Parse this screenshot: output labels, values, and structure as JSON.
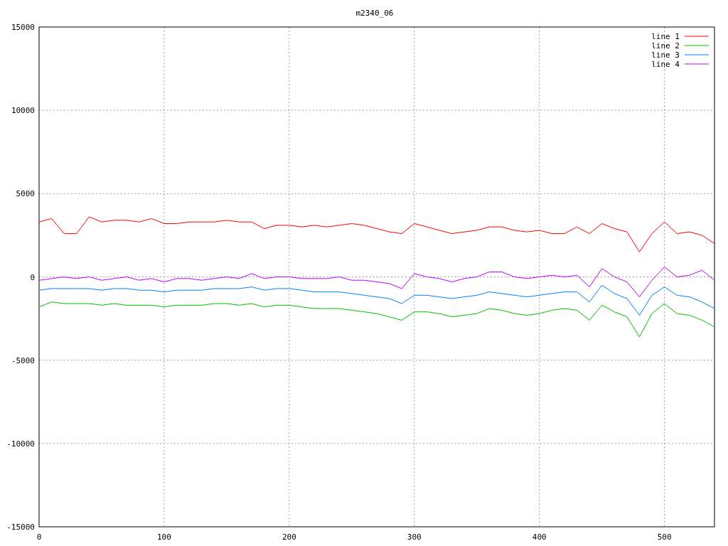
{
  "chart_data": {
    "type": "line",
    "title": "m2340_06",
    "grid": true,
    "legend": true,
    "xlim": [
      0,
      540
    ],
    "ylim": [
      -15000,
      15000
    ],
    "xticks": [
      0,
      100,
      200,
      300,
      400,
      500
    ],
    "yticks": [
      -15000,
      -10000,
      -5000,
      0,
      5000,
      10000,
      15000
    ],
    "x": [
      0,
      10,
      20,
      30,
      40,
      50,
      60,
      70,
      80,
      90,
      100,
      110,
      120,
      130,
      140,
      150,
      160,
      170,
      180,
      190,
      200,
      210,
      220,
      230,
      240,
      250,
      260,
      270,
      280,
      290,
      300,
      310,
      320,
      330,
      340,
      350,
      360,
      370,
      380,
      390,
      400,
      410,
      420,
      430,
      440,
      450,
      460,
      470,
      480,
      490,
      500,
      510,
      520,
      530,
      540
    ],
    "series": [
      {
        "name": "line 1",
        "color": "#ff0000",
        "values": [
          3300,
          3500,
          2600,
          2600,
          3600,
          3300,
          3400,
          3400,
          3300,
          3500,
          3200,
          3200,
          3300,
          3300,
          3300,
          3400,
          3300,
          3300,
          2900,
          3100,
          3100,
          3000,
          3100,
          3000,
          3100,
          3200,
          3100,
          2900,
          2700,
          2600,
          3200,
          3000,
          2800,
          2600,
          2700,
          2800,
          3000,
          3000,
          2800,
          2700,
          2800,
          2600,
          2600,
          3000,
          2600,
          3200,
          2900,
          2700,
          1500,
          2600,
          3300,
          2600,
          2700,
          2500,
          2000
        ]
      },
      {
        "name": "line 2",
        "color": "#00c000",
        "values": [
          -1800,
          -1500,
          -1600,
          -1600,
          -1600,
          -1700,
          -1600,
          -1700,
          -1700,
          -1700,
          -1800,
          -1700,
          -1700,
          -1700,
          -1600,
          -1600,
          -1700,
          -1600,
          -1800,
          -1700,
          -1700,
          -1800,
          -1900,
          -1900,
          -1900,
          -2000,
          -2100,
          -2200,
          -2400,
          -2600,
          -2100,
          -2100,
          -2200,
          -2400,
          -2300,
          -2200,
          -1900,
          -2000,
          -2200,
          -2300,
          -2200,
          -2000,
          -1900,
          -2000,
          -2600,
          -1700,
          -2100,
          -2400,
          -3600,
          -2200,
          -1600,
          -2200,
          -2300,
          -2600,
          -3000
        ]
      },
      {
        "name": "line 3",
        "color": "#0080ff",
        "values": [
          -800,
          -700,
          -700,
          -700,
          -700,
          -800,
          -700,
          -700,
          -800,
          -800,
          -900,
          -800,
          -800,
          -800,
          -700,
          -700,
          -700,
          -600,
          -800,
          -700,
          -700,
          -800,
          -900,
          -900,
          -900,
          -1000,
          -1100,
          -1200,
          -1300,
          -1600,
          -1100,
          -1100,
          -1200,
          -1300,
          -1200,
          -1100,
          -900,
          -1000,
          -1100,
          -1200,
          -1100,
          -1000,
          -900,
          -900,
          -1500,
          -500,
          -1000,
          -1300,
          -2300,
          -1100,
          -600,
          -1100,
          -1200,
          -1500,
          -1900
        ]
      },
      {
        "name": "line 4",
        "color": "#c000ff",
        "values": [
          -200,
          -100,
          0,
          -100,
          0,
          -200,
          -100,
          0,
          -200,
          -100,
          -300,
          -100,
          -100,
          -200,
          -100,
          0,
          -100,
          200,
          -100,
          0,
          0,
          -100,
          -100,
          -100,
          0,
          -200,
          -200,
          -300,
          -400,
          -700,
          200,
          0,
          -100,
          -300,
          -100,
          0,
          300,
          300,
          0,
          -100,
          0,
          100,
          0,
          100,
          -600,
          500,
          0,
          -300,
          -1200,
          -200,
          600,
          0,
          100,
          400,
          -200
        ]
      }
    ]
  }
}
